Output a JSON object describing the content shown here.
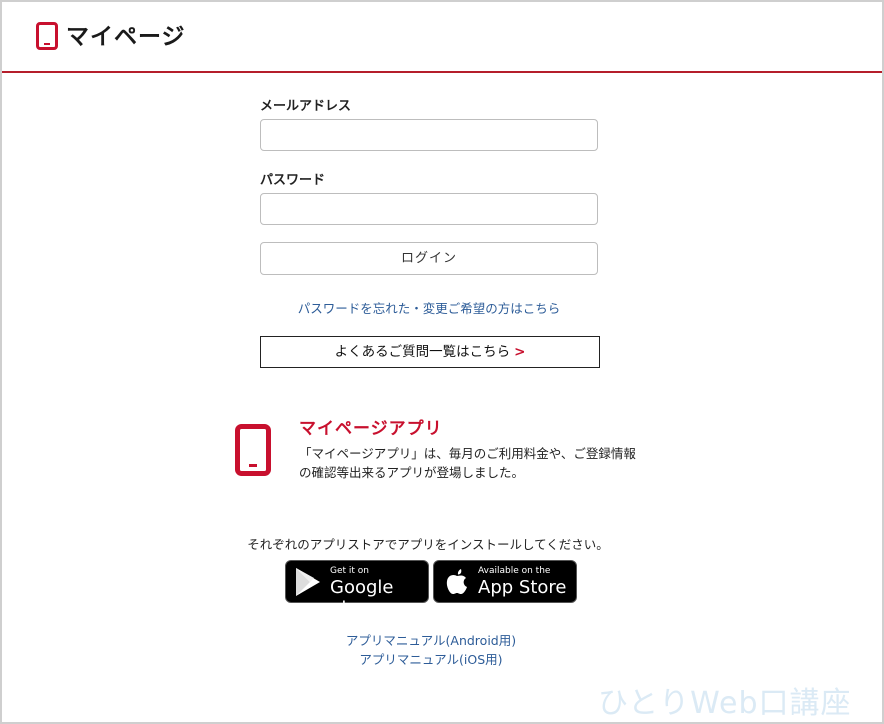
{
  "header": {
    "title": "マイページ",
    "icon": "smartphone-icon",
    "accent_color": "#b51e2b"
  },
  "form": {
    "email_label": "メールアドレス",
    "email_value": "",
    "password_label": "パスワード",
    "password_value": "",
    "login_label": "ログイン",
    "forgot_link": "パスワードを忘れた・変更ご希望の方はこちら",
    "faq_label": "よくあるご質問一覧はこちら",
    "faq_arrow": ">"
  },
  "app": {
    "title": "マイページアプリ",
    "description": "「マイページアプリ」は、毎月のご利用料金や、ご登録情報の確認等出来るアプリが登場しました。",
    "install_text": "それぞれのアプリストアでアプリをインストールしてください。",
    "google_play": {
      "small": "Get it on",
      "big": "Google play"
    },
    "app_store": {
      "small": "Available on the",
      "big": "App Store"
    },
    "manual_android": "アプリマニュアル(Android用)",
    "manual_ios": "アプリマニュアル(iOS用)"
  },
  "watermark": "ひとりWeb口講座",
  "colors": {
    "brand_red": "#c8102e",
    "link_blue": "#2d5c98"
  }
}
